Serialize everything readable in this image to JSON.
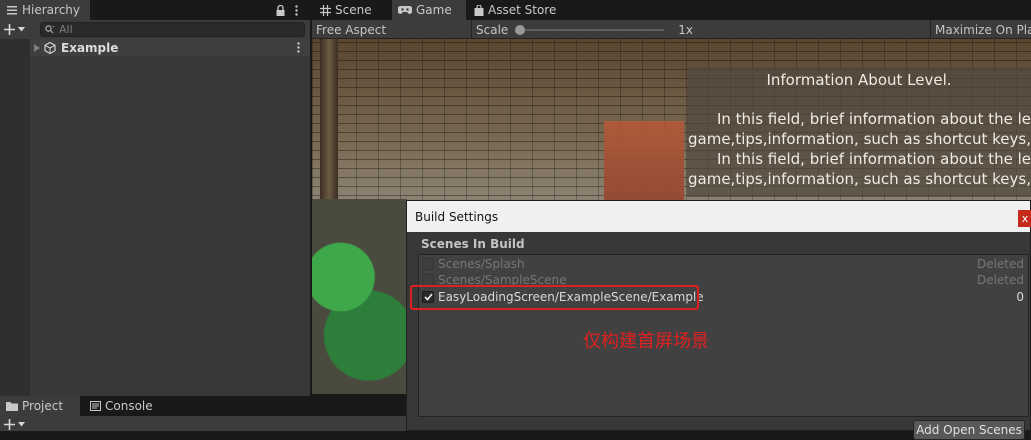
{
  "hierarchy": {
    "tab_label": "Hierarchy",
    "search_placeholder": "All",
    "root_item": "Example"
  },
  "view_tabs": {
    "scene": "Scene",
    "game": "Game",
    "asset_store": "Asset Store"
  },
  "game_toolbar": {
    "aspect": "Free Aspect",
    "scale_label": "Scale",
    "scale_value": "1x",
    "maximize": "Maximize On Play"
  },
  "game_view": {
    "info_title": "Information About Level.",
    "info_lines": [
      "In this field, brief information about the le",
      "game,tips,information, such as shortcut keys,",
      "In this field, brief information about the le",
      "game,tips,information, such as shortcut keys,"
    ]
  },
  "bottom_tabs": {
    "project": "Project",
    "console": "Console"
  },
  "build_settings": {
    "title": "Build Settings",
    "close_glyph": "x",
    "section_label": "Scenes In Build",
    "scenes": [
      {
        "path": "Scenes/Splash",
        "status": "Deleted",
        "checked": false
      },
      {
        "path": "Scenes/SampleScene",
        "status": "Deleted",
        "checked": false
      },
      {
        "path": "EasyLoadingScreen/ExampleScene/Example",
        "status": "0",
        "checked": true
      }
    ],
    "annotation": "仅构建首屏场景",
    "add_open_scenes": "Add Open Scenes"
  },
  "colors": {
    "highlight_border": "#e02020",
    "annotation_text": "#e02020",
    "active_tab": "#3c3c3c",
    "panel": "#383838"
  }
}
